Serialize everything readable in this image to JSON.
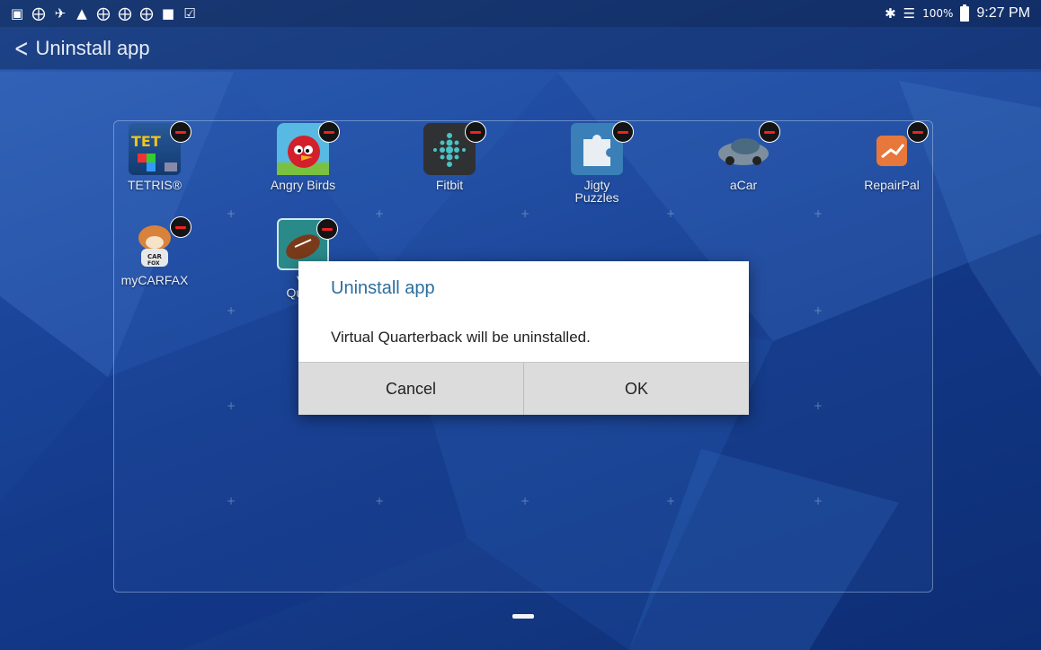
{
  "status_bar": {
    "notification_icons": [
      "image-icon",
      "signal-grid-icon",
      "voicemail-icon",
      "warning-icon",
      "signal-grid-icon",
      "signal-grid-icon",
      "signal-grid-icon",
      "shopping-bag-icon",
      "checked-bag-icon"
    ],
    "battery_percent": "100%",
    "time": "9:27 PM"
  },
  "action_bar": {
    "title": "Uninstall app"
  },
  "apps": [
    {
      "name": "TETRIS®",
      "icon": "tetris-icon"
    },
    {
      "name": "Angry Birds",
      "icon": "angry-birds-icon"
    },
    {
      "name": "Fitbit",
      "icon": "fitbit-icon"
    },
    {
      "name": "Jigty Puzzles",
      "icon": "jigty-puzzles-icon"
    },
    {
      "name": "aCar",
      "icon": "acar-icon"
    },
    {
      "name": "RepairPal",
      "icon": "repairpal-icon"
    },
    {
      "name": "myCARFAX",
      "icon": "mycarfax-icon"
    },
    {
      "name": "Virtual Quarterback",
      "icon": "virtual-quarterback-icon",
      "visible_label": "Vi Quart"
    }
  ],
  "dialog": {
    "title": "Uninstall app",
    "message": "Virtual Quarterback will be uninstalled.",
    "cancel_label": "Cancel",
    "ok_label": "OK"
  },
  "colors": {
    "dialog_title": "#2c6e9f",
    "remove_badge": "#e22222",
    "wallpaper": "#1e4aa0"
  }
}
